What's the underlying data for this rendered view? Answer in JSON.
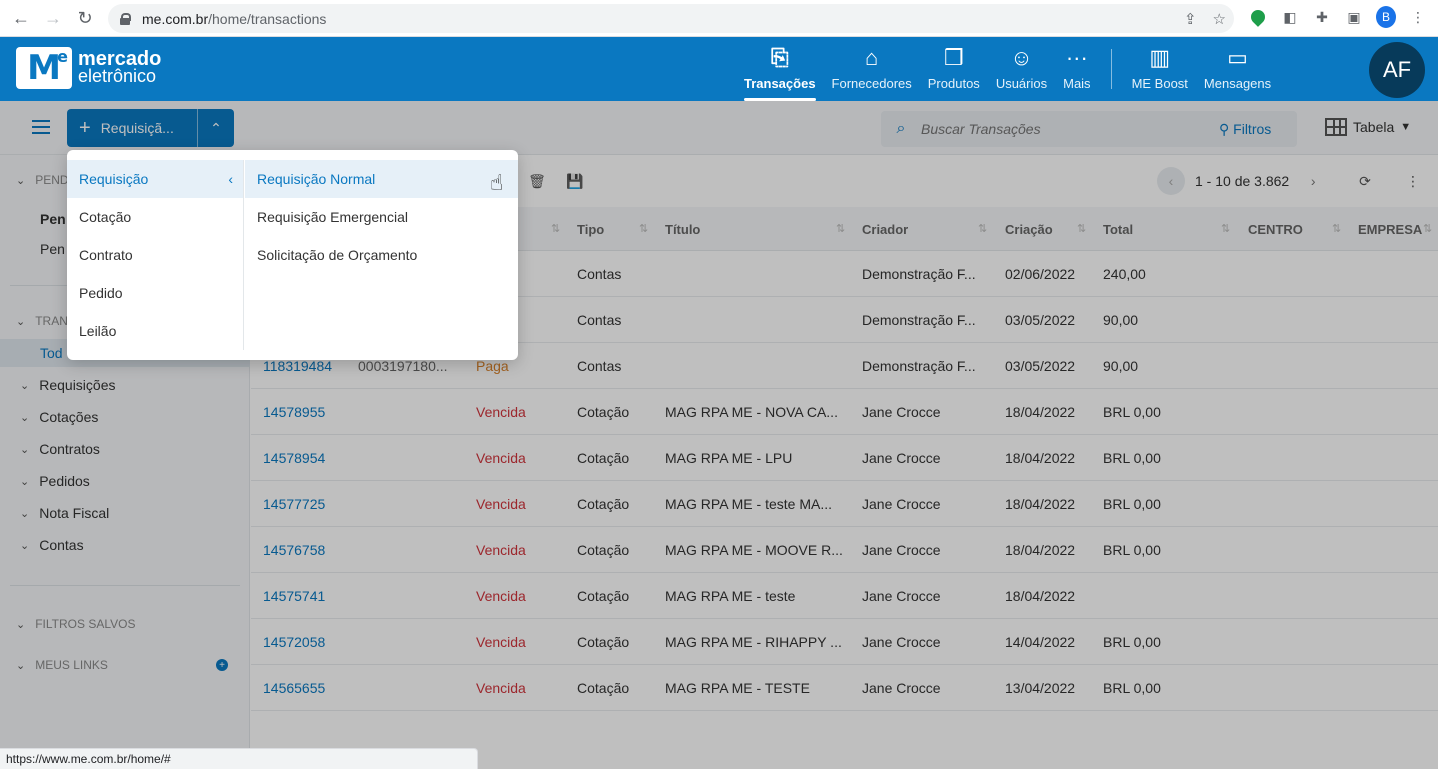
{
  "browser": {
    "url_host": "me.com.br",
    "url_path": "/home/transactions",
    "profile_initial": "B"
  },
  "header": {
    "logo_line1": "mercado",
    "logo_line2": "eletrônico",
    "logo_mark": "M",
    "logo_mark_sup": "e",
    "nav": [
      {
        "label": "Transações",
        "icon": "transactions-icon"
      },
      {
        "label": "Fornecedores",
        "icon": "store-icon"
      },
      {
        "label": "Produtos",
        "icon": "box-icon"
      },
      {
        "label": "Usuários",
        "icon": "users-icon"
      },
      {
        "label": "Mais",
        "icon": "more-icon"
      },
      {
        "label": "ME Boost",
        "icon": "chart-icon"
      },
      {
        "label": "Mensagens",
        "icon": "message-icon"
      }
    ],
    "avatar": "AF"
  },
  "toolbar": {
    "new_label": "Requisiçã...",
    "search_placeholder": "Buscar Transações",
    "filters_label": "Filtros",
    "view_label": "Tabela"
  },
  "sidebar": {
    "pend_section": "PEND",
    "pend_sub1": "Pen",
    "pend_sub2": "Pen",
    "tran_section": "TRAN",
    "tran_active": "Tod",
    "groups": [
      "Requisições",
      "Cotações",
      "Contratos",
      "Pedidos",
      "Nota Fiscal",
      "Contas"
    ],
    "saved_filters": "FILTROS SALVOS",
    "my_links": "MEUS LINKS"
  },
  "pager": {
    "text": "1 - 10 de 3.862"
  },
  "table": {
    "headers": [
      "Tipo",
      "Título",
      "Criador",
      "Criação",
      "Total",
      "CENTRO",
      "EMPRESA"
    ],
    "rows": [
      {
        "id": "",
        "code": "",
        "status": "",
        "tipo": "Contas",
        "titulo": "",
        "criador": "Demonstração F...",
        "criacao": "02/06/2022",
        "total": "240,00"
      },
      {
        "id": "",
        "code": "",
        "status": "",
        "tipo": "Contas",
        "titulo": "",
        "criador": "Demonstração F...",
        "criacao": "03/05/2022",
        "total": "90,00"
      },
      {
        "id": "118319484",
        "code": "0003197180...",
        "status": "Paga",
        "tipo": "Contas",
        "titulo": "",
        "criador": "Demonstração F...",
        "criacao": "03/05/2022",
        "total": "90,00"
      },
      {
        "id": "14578955",
        "code": "",
        "status": "Vencida",
        "tipo": "Cotação",
        "titulo": "MAG RPA ME - NOVA CA...",
        "criador": "Jane Crocce",
        "criacao": "18/04/2022",
        "total": "BRL 0,00"
      },
      {
        "id": "14578954",
        "code": "",
        "status": "Vencida",
        "tipo": "Cotação",
        "titulo": "MAG RPA ME - LPU",
        "criador": "Jane Crocce",
        "criacao": "18/04/2022",
        "total": "BRL 0,00"
      },
      {
        "id": "14577725",
        "code": "",
        "status": "Vencida",
        "tipo": "Cotação",
        "titulo": "MAG RPA ME - teste MA...",
        "criador": "Jane Crocce",
        "criacao": "18/04/2022",
        "total": "BRL 0,00"
      },
      {
        "id": "14576758",
        "code": "",
        "status": "Vencida",
        "tipo": "Cotação",
        "titulo": "MAG RPA ME - MOOVE R...",
        "criador": "Jane Crocce",
        "criacao": "18/04/2022",
        "total": "BRL 0,00"
      },
      {
        "id": "14575741",
        "code": "",
        "status": "Vencida",
        "tipo": "Cotação",
        "titulo": "MAG RPA ME - teste",
        "criador": "Jane Crocce",
        "criacao": "18/04/2022",
        "total": ""
      },
      {
        "id": "14572058",
        "code": "",
        "status": "Vencida",
        "tipo": "Cotação",
        "titulo": "MAG RPA ME - RIHAPPY ...",
        "criador": "Jane Crocce",
        "criacao": "14/04/2022",
        "total": "BRL 0,00"
      },
      {
        "id": "14565655",
        "code": "",
        "status": "Vencida",
        "tipo": "Cotação",
        "titulo": "MAG RPA ME - TESTE",
        "criador": "Jane Crocce",
        "criacao": "13/04/2022",
        "total": "BRL 0,00"
      }
    ]
  },
  "dropdown": {
    "left": [
      "Requisição",
      "Cotação",
      "Contrato",
      "Pedido",
      "Leilão"
    ],
    "right": [
      "Requisição Normal",
      "Requisição Emergencial",
      "Solicitação de Orçamento"
    ]
  },
  "statusbar": {
    "text": "https://www.me.com.br/home/#"
  },
  "colors": {
    "brand": "#0a78c1",
    "danger": "#d0343c",
    "warning": "#d9822b"
  }
}
